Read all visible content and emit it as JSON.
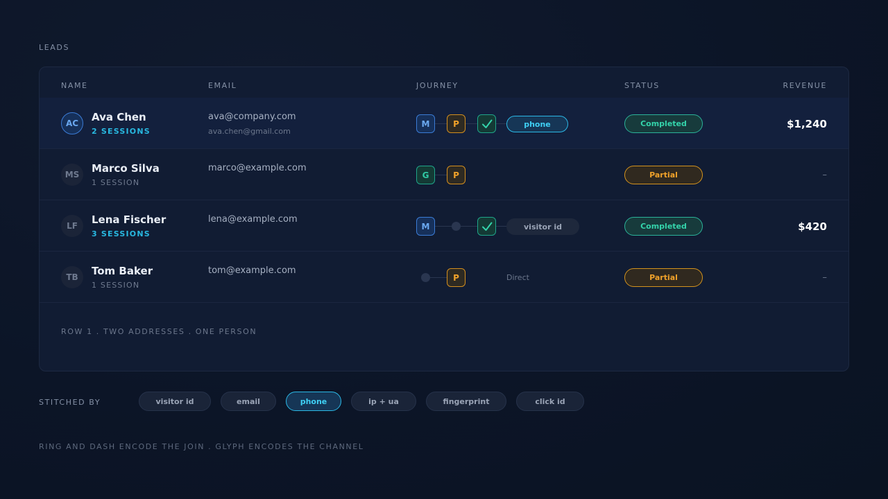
{
  "section_label": "LEADS",
  "columns": {
    "name": "NAME",
    "email": "EMAIL",
    "journey": "JOURNEY",
    "status": "STATUS",
    "revenue": "REVENUE"
  },
  "rows": [
    {
      "initials": "AC",
      "name": "Ava Chen",
      "sessions": "2 SESSIONS",
      "email": "ava@company.com",
      "email_alt": "ava.chen@gmail.com",
      "journey": {
        "steps": [
          "M",
          "P",
          "check"
        ],
        "channel": "phone"
      },
      "status": "Completed",
      "revenue": "$1,240"
    },
    {
      "initials": "MS",
      "name": "Marco Silva",
      "sessions": "1 SESSION",
      "email": "marco@example.com",
      "journey": {
        "steps": [
          "G",
          "P"
        ]
      },
      "status": "Partial",
      "revenue": "–"
    },
    {
      "initials": "LF",
      "name": "Lena Fischer",
      "sessions": "3 SESSIONS",
      "email": "lena@example.com",
      "journey": {
        "steps": [
          "M",
          "dot",
          "check"
        ],
        "channel": "visitor id"
      },
      "status": "Completed",
      "revenue": "$420"
    },
    {
      "initials": "TB",
      "name": "Tom Baker",
      "sessions": "1 SESSION",
      "email": "tom@example.com",
      "journey": {
        "steps": [
          "dot",
          "P"
        ],
        "channel": "Direct"
      },
      "status": "Partial",
      "revenue": "–"
    }
  ],
  "footnote": "ROW 1 . TWO ADDRESSES . ONE PERSON",
  "stitched_by": {
    "label": "STITCHED BY",
    "pills": [
      "visitor id",
      "email",
      "phone",
      "ip + ua",
      "fingerprint",
      "click id"
    ],
    "selected": "phone"
  },
  "caption": "RING AND DASH ENCODE THE JOIN . GLYPH ENCODES THE CHANNEL",
  "colors": {
    "background": "#0c1527",
    "card": "#111c33",
    "accent_cyan": "#3fd0f5",
    "completed": "#34d3aa",
    "partial": "#f0a22a",
    "meta_blue": "#6aa8f0"
  },
  "icons": {
    "check": "checkmark-icon",
    "dot": "step-dot-icon"
  }
}
